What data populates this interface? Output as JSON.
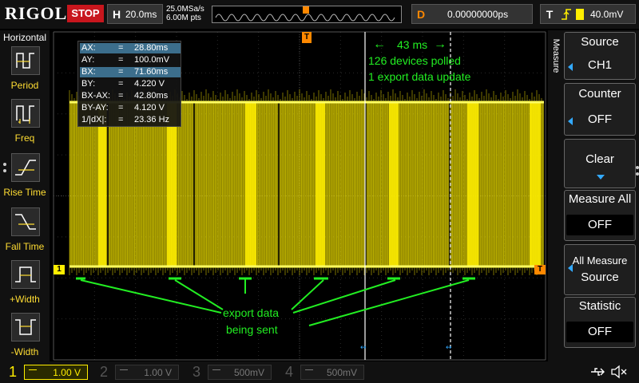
{
  "brand": "RIGOL",
  "run_state": "STOP",
  "horizontal": {
    "key": "H",
    "timebase": "20.0ms",
    "sample_rate": "25.0MSa/s",
    "memory_depth": "6.00M pts"
  },
  "delay": {
    "key": "D",
    "value": "0.00000000ps"
  },
  "trigger": {
    "key": "T",
    "level": "40.0mV"
  },
  "left_menu": {
    "title": "Horizontal",
    "items": [
      {
        "label": "Period",
        "icon": "period-icon"
      },
      {
        "label": "Freq",
        "icon": "freq-icon"
      },
      {
        "label": "Rise Time",
        "icon": "rise-time-icon"
      },
      {
        "label": "Fall Time",
        "icon": "fall-time-icon"
      },
      {
        "label": "+Width",
        "icon": "positive-width-icon"
      },
      {
        "label": "-Width",
        "icon": "negative-width-icon"
      }
    ]
  },
  "right_menu": {
    "title": "Measure",
    "source": {
      "label": "Source",
      "value": "CH1"
    },
    "counter": {
      "label": "Counter",
      "value": "OFF"
    },
    "clear": {
      "label": "Clear"
    },
    "measure_all": {
      "label": "Measure All",
      "value": "OFF"
    },
    "all_measure_source": {
      "label1": "All Measure",
      "label2": "Source"
    },
    "statistic": {
      "label": "Statistic",
      "value": "OFF"
    }
  },
  "cursors": {
    "ax": {
      "label": "AX:",
      "eq": "=",
      "value": "28.80ms"
    },
    "ay": {
      "label": "AY:",
      "eq": "=",
      "value": "100.0mV"
    },
    "bx": {
      "label": "BX:",
      "eq": "=",
      "value": "71.60ms"
    },
    "by": {
      "label": "BY:",
      "eq": "=",
      "value": "4.220 V"
    },
    "bx_ax": {
      "label": "BX-AX:",
      "eq": "=",
      "value": "42.80ms"
    },
    "by_ay": {
      "label": "BY-AY:",
      "eq": "=",
      "value": "4.120 V"
    },
    "inv_dx": {
      "label": "1/|dX|:",
      "eq": "=",
      "value": "23.36 Hz"
    }
  },
  "annotations": {
    "interval": "43 ms",
    "line1": "126 devices polled",
    "line2": "1 export data update",
    "export_line1": "export data",
    "export_line2": "being sent"
  },
  "markers": {
    "ch1": "1",
    "trigger_level": "T",
    "trigger_pos": "T"
  },
  "channels": [
    {
      "num": "1",
      "scale": "1.00 V",
      "color": "#ffee00",
      "active": true
    },
    {
      "num": "2",
      "scale": "1.00 V",
      "color": "#00e5ff",
      "active": false
    },
    {
      "num": "3",
      "scale": "500mV",
      "color": "#ff44ff",
      "active": false
    },
    {
      "num": "4",
      "scale": "500mV",
      "color": "#3377ff",
      "active": false
    }
  ],
  "colors": {
    "ch1": "#ffee00",
    "annotation": "#22ee22",
    "cursor": "#ffffff",
    "marker": "#ff8800",
    "stop": "#c8161d"
  }
}
